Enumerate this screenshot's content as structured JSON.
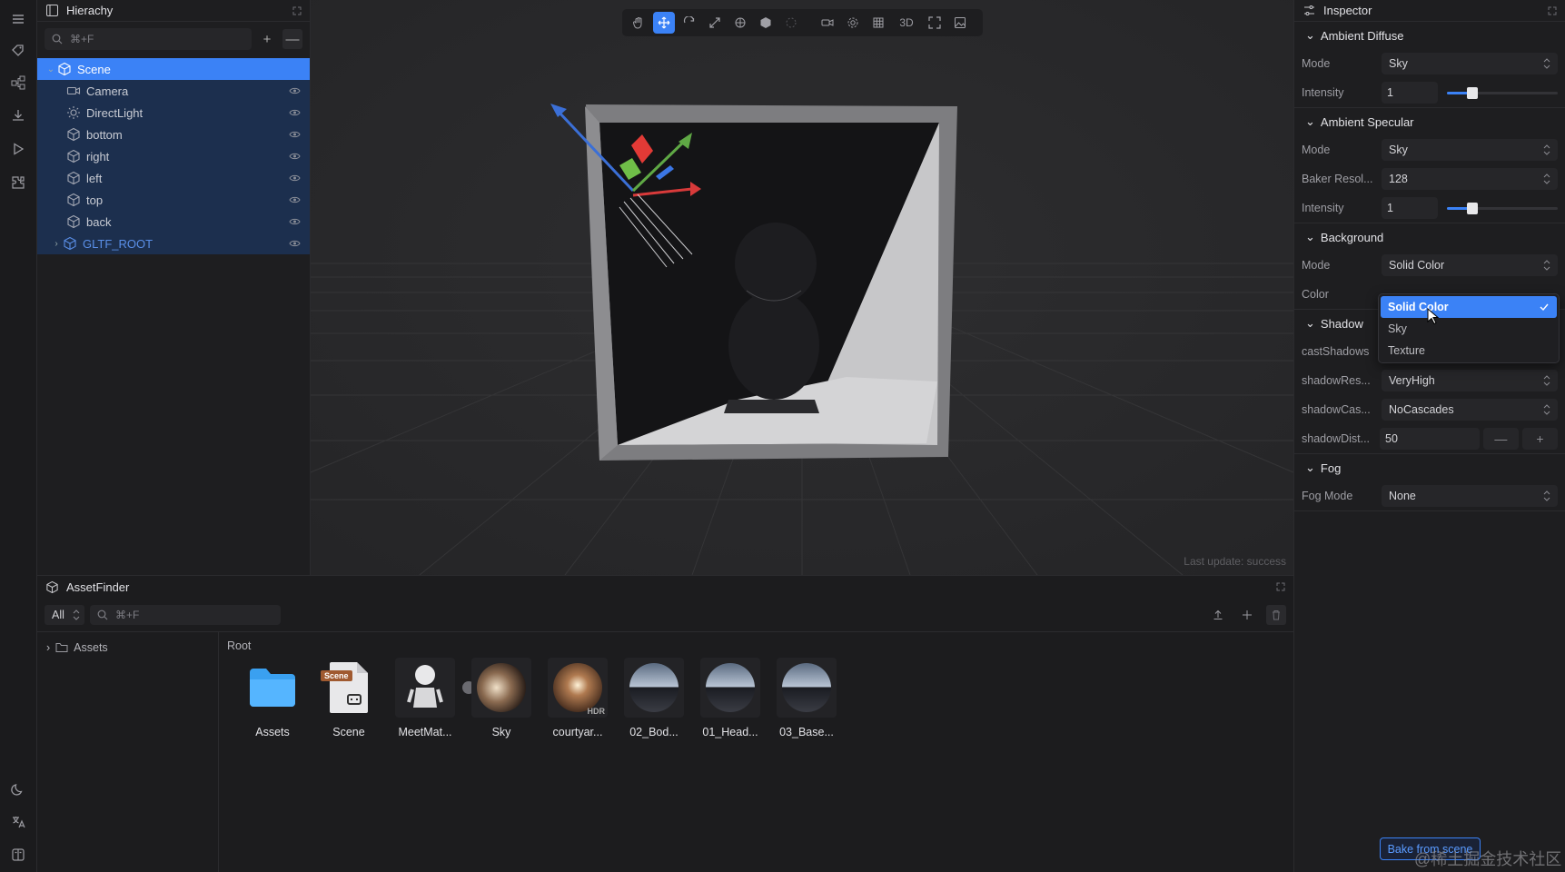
{
  "rail": {
    "icons": [
      "menu-icon",
      "sparkle-tag-icon",
      "node-graph-icon",
      "download-icon",
      "play-icon",
      "plugin-icon",
      "moon-icon",
      "translate-icon",
      "book-icon"
    ]
  },
  "hierarchy": {
    "title": "Hierachy",
    "search_placeholder": "⌘+F",
    "add_label": "+",
    "remove_label": "—",
    "items": [
      {
        "label": "Scene",
        "icon": "cube-icon"
      },
      {
        "label": "Camera",
        "icon": "camera-icon"
      },
      {
        "label": "DirectLight",
        "icon": "sun-icon"
      },
      {
        "label": "bottom",
        "icon": "cube-icon"
      },
      {
        "label": "right",
        "icon": "cube-icon"
      },
      {
        "label": "left",
        "icon": "cube-icon"
      },
      {
        "label": "top",
        "icon": "cube-icon"
      },
      {
        "label": "back",
        "icon": "cube-icon"
      },
      {
        "label": "GLTF_ROOT",
        "icon": "cube-icon"
      }
    ]
  },
  "viewport": {
    "toolbar_3d_label": "3D",
    "status": "Last update: success"
  },
  "inspector": {
    "title": "Inspector",
    "ambient_diffuse": {
      "title": "Ambient Diffuse",
      "mode_label": "Mode",
      "mode_value": "Sky",
      "intensity_label": "Intensity",
      "intensity_value": "1"
    },
    "ambient_specular": {
      "title": "Ambient Specular",
      "mode_label": "Mode",
      "mode_value": "Sky",
      "baker_label": "Baker Resol...",
      "baker_value": "128",
      "intensity_label": "Intensity",
      "intensity_value": "1"
    },
    "background": {
      "title": "Background",
      "mode_label": "Mode",
      "mode_value": "Solid Color",
      "color_label": "Color",
      "options": [
        "Solid Color",
        "Sky",
        "Texture"
      ]
    },
    "shadow": {
      "title": "Shadow",
      "cast_label": "castShadows",
      "res_label": "shadowRes...",
      "res_value": "VeryHigh",
      "cascades_label": "shadowCas...",
      "cascades_value": "NoCascades",
      "dist_label": "shadowDist...",
      "dist_value": "50",
      "minus_label": "—",
      "plus_label": "+"
    },
    "fog": {
      "title": "Fog",
      "mode_label": "Fog Mode",
      "mode_value": "None"
    },
    "bake_button": "Bake from scene"
  },
  "watermark": "@稀土掘金技术社区",
  "assetfinder": {
    "title": "AssetFinder",
    "filter_value": "All",
    "search_placeholder": "⌘+F",
    "tree_root": "Assets",
    "root_label": "Root",
    "items": [
      {
        "name": "Assets",
        "kind": "folder"
      },
      {
        "name": "Scene",
        "kind": "scene",
        "badge": "Scene"
      },
      {
        "name": "MeetMat...",
        "kind": "model"
      },
      {
        "name": "Sky",
        "kind": "hdr-sky"
      },
      {
        "name": "courtyar...",
        "kind": "hdr",
        "badge": "HDR"
      },
      {
        "name": "02_Bod...",
        "kind": "material"
      },
      {
        "name": "01_Head...",
        "kind": "material"
      },
      {
        "name": "03_Base...",
        "kind": "material"
      }
    ]
  },
  "colors": {
    "accent": "#3b82f6",
    "panel": "#1e1e20",
    "viewport": "#28282a"
  }
}
